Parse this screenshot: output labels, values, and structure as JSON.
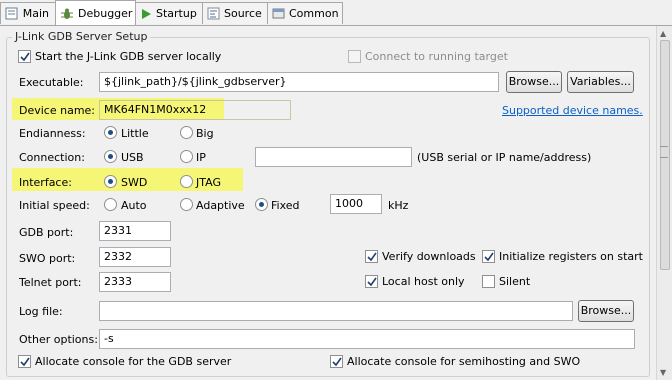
{
  "tabs": [
    {
      "label": "Main",
      "icon": "main-tab-icon"
    },
    {
      "label": "Debugger",
      "icon": "debugger-tab-icon"
    },
    {
      "label": "Startup",
      "icon": "startup-play-icon"
    },
    {
      "label": "Source",
      "icon": "source-tab-icon"
    },
    {
      "label": "Common",
      "icon": "common-tab-icon"
    }
  ],
  "section": {
    "title": "J-Link GDB Server Setup"
  },
  "start_local": {
    "label": "Start the J-Link GDB server locally",
    "checked": true
  },
  "connect_running": {
    "label": "Connect to running target",
    "checked": false,
    "enabled": false
  },
  "executable": {
    "label": "Executable:",
    "value": "${jlink_path}/${jlink_gdbserver}",
    "browse": "Browse...",
    "variables": "Variables..."
  },
  "device": {
    "label": "Device name:",
    "value": "MK64FN1M0xxx12",
    "link": "Supported device names."
  },
  "endianness": {
    "label": "Endianness:",
    "options": [
      "Little",
      "Big"
    ],
    "selected": "Little"
  },
  "connection": {
    "label": "Connection:",
    "options": [
      "USB",
      "IP"
    ],
    "selected": "USB",
    "ip_value": "",
    "hint": "(USB serial or IP name/address)"
  },
  "interface": {
    "label": "Interface:",
    "options": [
      "SWD",
      "JTAG"
    ],
    "selected": "SWD"
  },
  "speed": {
    "label": "Initial speed:",
    "options": [
      "Auto",
      "Adaptive",
      "Fixed"
    ],
    "selected": "Fixed",
    "value": "1000",
    "unit": "kHz"
  },
  "gdb_port": {
    "label": "GDB port:",
    "value": "2331"
  },
  "swo_port": {
    "label": "SWO port:",
    "value": "2332"
  },
  "telnet_port": {
    "label": "Telnet port:",
    "value": "2333"
  },
  "verify_downloads": {
    "label": "Verify downloads",
    "checked": true
  },
  "init_registers": {
    "label": "Initialize registers on start",
    "checked": true
  },
  "local_host_only": {
    "label": "Local host only",
    "checked": true
  },
  "silent": {
    "label": "Silent",
    "checked": false
  },
  "log_file": {
    "label": "Log file:",
    "value": "",
    "browse": "Browse..."
  },
  "other_options": {
    "label": "Other options:",
    "value": "-s"
  },
  "alloc_gdb_console": {
    "label": "Allocate console for the GDB server",
    "checked": true
  },
  "alloc_semihost_console": {
    "label": "Allocate console for semihosting and SWO",
    "checked": true
  },
  "colors": {
    "highlight": "#f5f576",
    "link": "#0a5fc9",
    "radio_dot": "#1a4f87"
  }
}
